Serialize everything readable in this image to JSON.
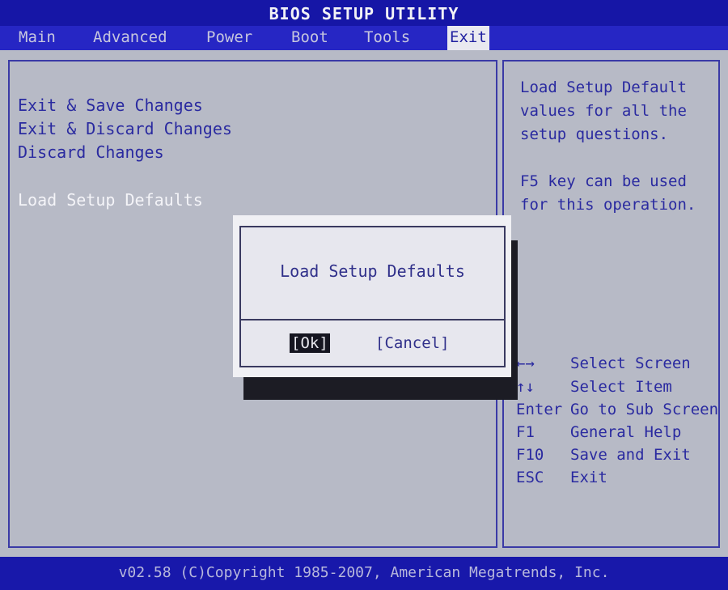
{
  "title": "BIOS SETUP UTILITY",
  "menu": {
    "tabs": [
      {
        "label": "Main"
      },
      {
        "label": "Advanced"
      },
      {
        "label": "Power"
      },
      {
        "label": "Boot"
      },
      {
        "label": "Tools"
      },
      {
        "label": "Exit"
      }
    ],
    "active": "Exit"
  },
  "options": [
    "Exit & Save Changes",
    "Exit & Discard Changes",
    "Discard Changes",
    "Load Setup Defaults"
  ],
  "help": {
    "line1": "Load Setup Default",
    "line2": "values for all the",
    "line3": "setup questions.",
    "line4": "F5 key can be used",
    "line5": "for this operation."
  },
  "keys": [
    {
      "key": "←→",
      "desc": "Select Screen"
    },
    {
      "key": "↑↓",
      "desc": "Select Item"
    },
    {
      "key": "Enter",
      "desc": "Go to Sub Screen"
    },
    {
      "key": "F1",
      "desc": "General Help"
    },
    {
      "key": "F10",
      "desc": "Save and Exit"
    },
    {
      "key": "ESC",
      "desc": "Exit"
    }
  ],
  "dialog": {
    "title": "Load Setup Defaults",
    "ok_label": "[Ok]",
    "cancel_label": "[Cancel]"
  },
  "footer": "v02.58 (C)Copyright 1985-2007, American Megatrends, Inc.",
  "colors": {
    "background": "#b7bac6",
    "menu_bar": "#2626c4",
    "text": "#2a2aa0",
    "selected_text": "#f4f4f8"
  }
}
